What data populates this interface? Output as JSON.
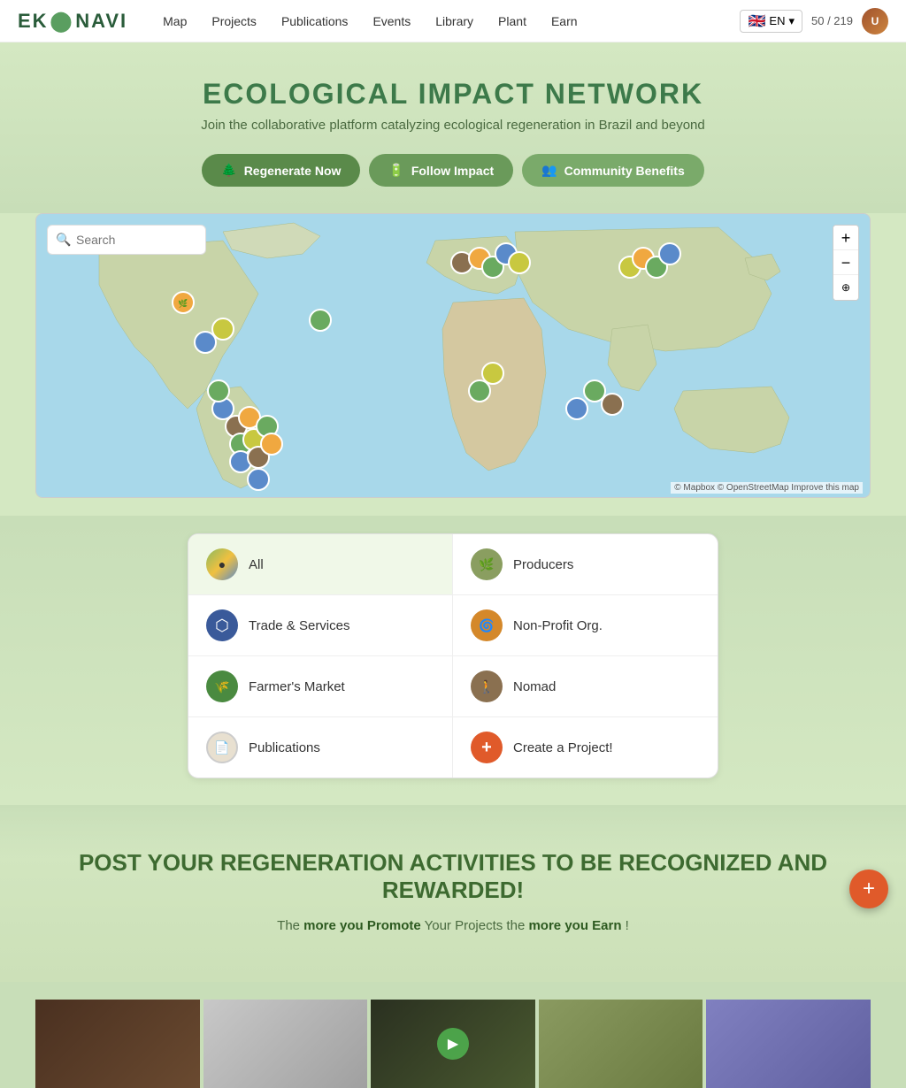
{
  "nav": {
    "logo": "EK⬤NAVI",
    "logo_leaf": "⬤",
    "links": [
      {
        "label": "Map",
        "href": "#"
      },
      {
        "label": "Projects",
        "href": "#"
      },
      {
        "label": "Publications",
        "href": "#"
      },
      {
        "label": "Events",
        "href": "#"
      },
      {
        "label": "Library",
        "href": "#"
      },
      {
        "label": "Plant",
        "href": "#"
      },
      {
        "label": "Earn",
        "href": "#"
      }
    ],
    "lang": "EN",
    "count": "50 / 219"
  },
  "hero": {
    "title": "ECOLOGICAL IMPACT NETWORK",
    "subtitle": "Join the collaborative platform catalyzing ecological regeneration in Brazil and beyond",
    "buttons": [
      {
        "label": "Regenerate Now",
        "icon": "🌲"
      },
      {
        "label": "Follow Impact",
        "icon": "🔋"
      },
      {
        "label": "Community Benefits",
        "icon": "👥"
      }
    ]
  },
  "map": {
    "search_placeholder": "Search",
    "zoom_in": "+",
    "zoom_out": "−",
    "compass": "⊕",
    "attribution": "© Mapbox © OpenStreetMap Improve this map"
  },
  "filters": {
    "items": [
      {
        "id": "all",
        "label": "All",
        "icon": "🔵",
        "color": "#c8d840",
        "active": true
      },
      {
        "id": "producers",
        "label": "Producers",
        "icon": "🌿",
        "color": "#8a9e60"
      },
      {
        "id": "trade",
        "label": "Trade & Services",
        "icon": "🔵",
        "color": "#4a6aaa"
      },
      {
        "id": "nonprofit",
        "label": "Non-Profit Org.",
        "icon": "🟠",
        "color": "#d4882a"
      },
      {
        "id": "farmers",
        "label": "Farmer's Market",
        "icon": "🟢",
        "color": "#4a8a40"
      },
      {
        "id": "nomad",
        "label": "Nomad",
        "icon": "🟤",
        "color": "#8a7050"
      },
      {
        "id": "publications",
        "label": "Publications",
        "icon": "⚪",
        "color": "#c8c8c8"
      },
      {
        "id": "create",
        "label": "Create a Project!",
        "icon": "➕",
        "color": "#e05a2a"
      }
    ]
  },
  "post_section": {
    "title": "POST YOUR REGENERATION ACTIVITIES TO BE RECOGNIZED AND REWARDED!",
    "subtitle_prefix": "The ",
    "subtitle_promote": "more you Promote",
    "subtitle_middle": " Your Projects the ",
    "subtitle_earn": "more you Earn",
    "subtitle_suffix": "!"
  },
  "fab": {
    "icon": "+"
  }
}
